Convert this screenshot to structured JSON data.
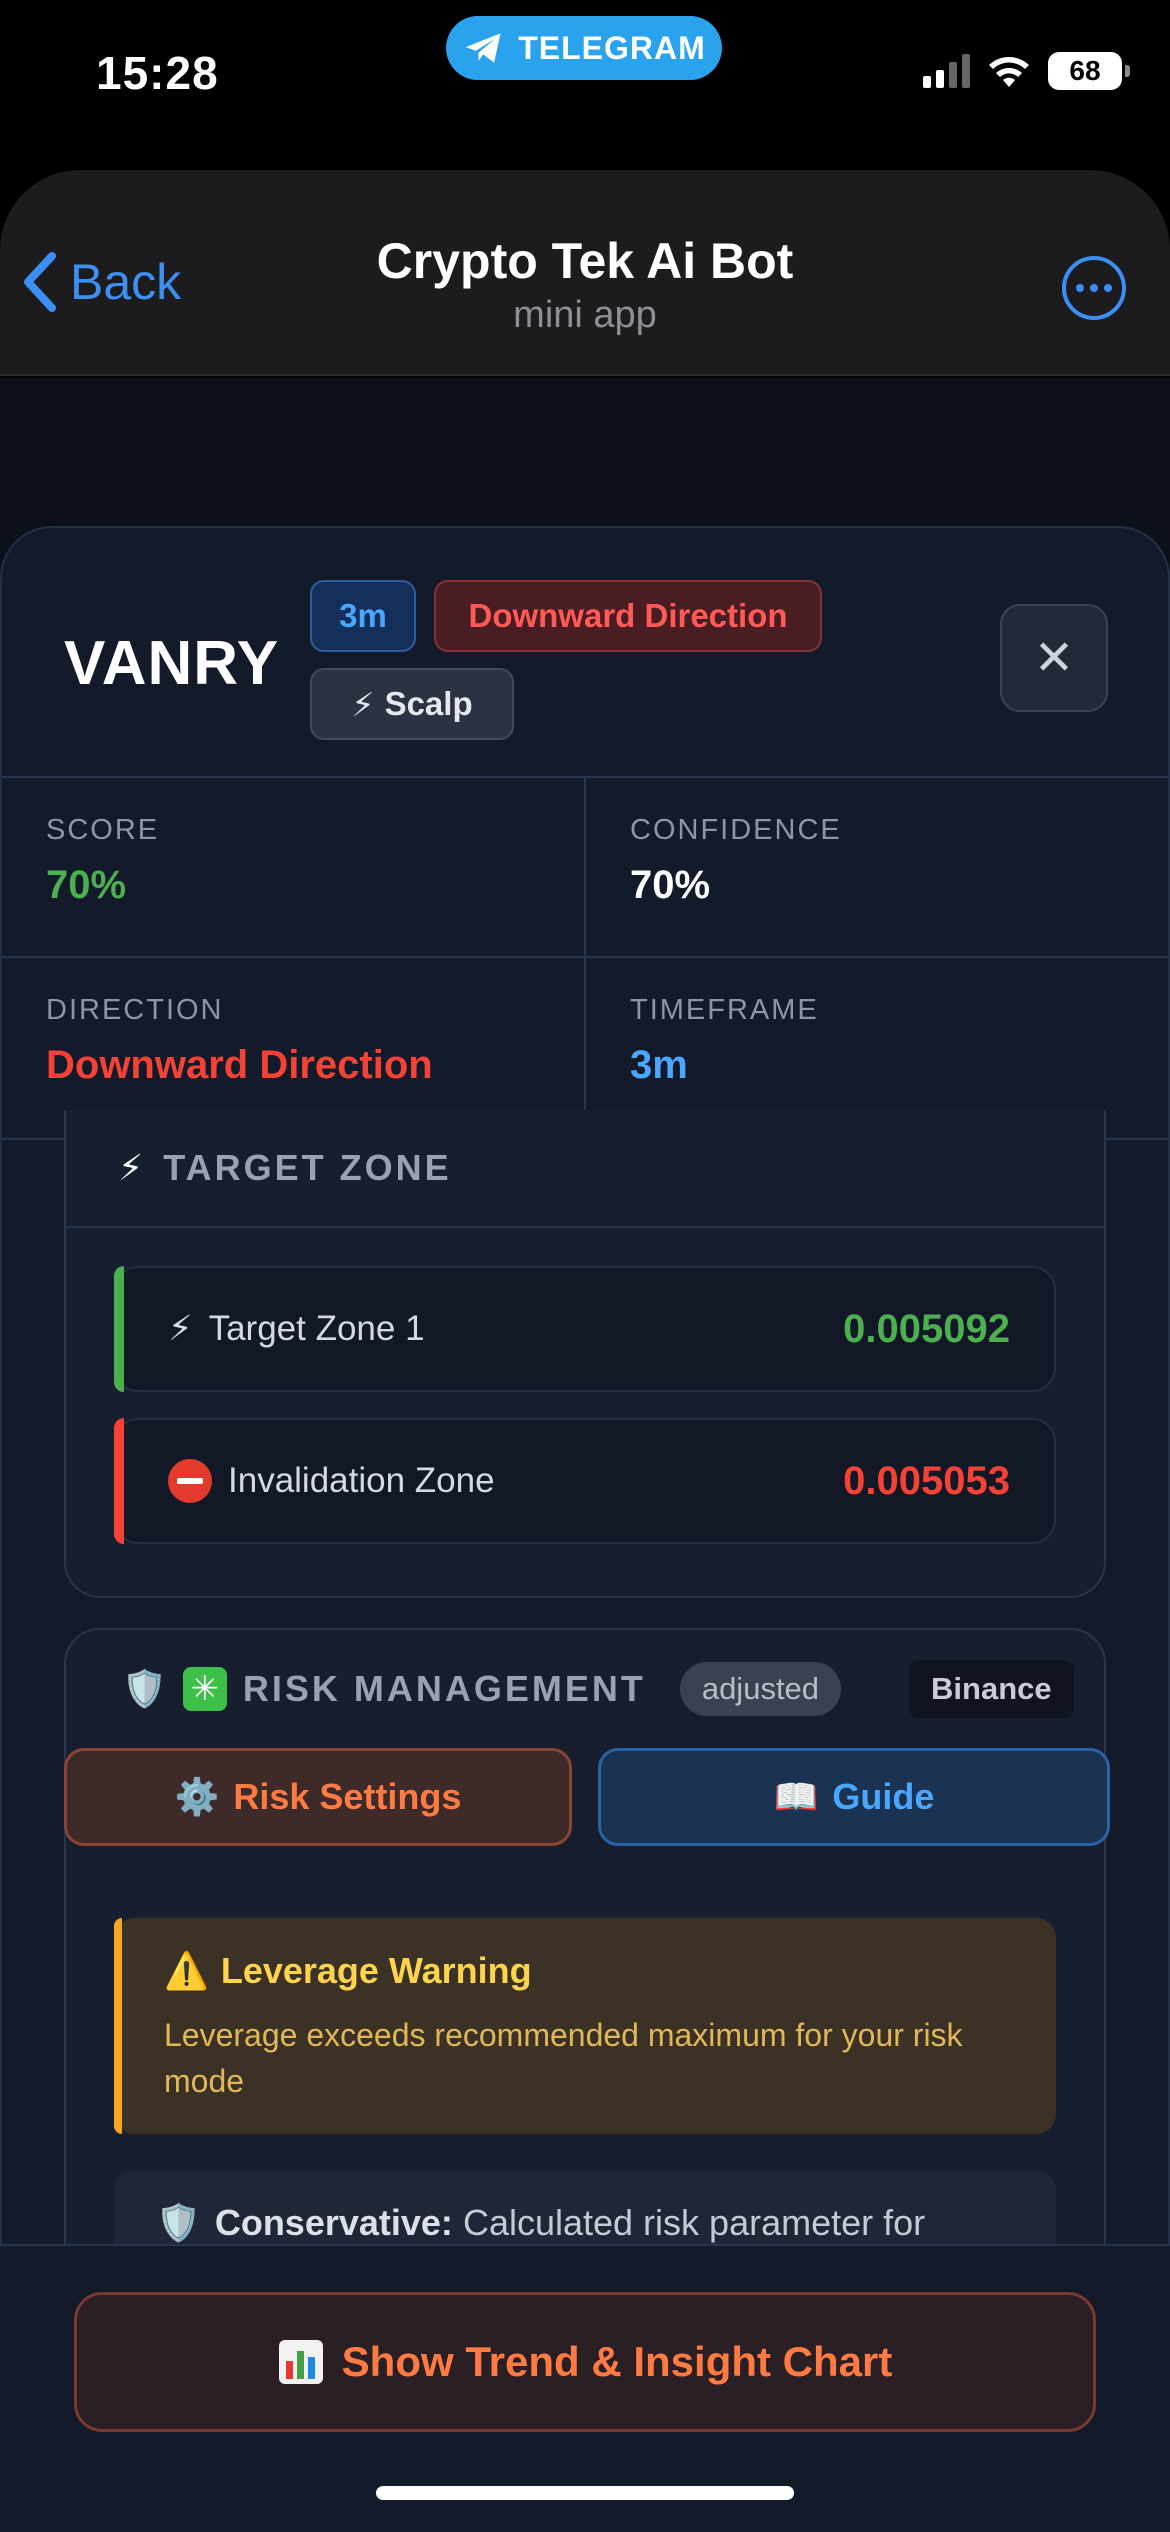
{
  "status_bar": {
    "time": "15:28",
    "app_pill": "TELEGRAM",
    "battery": "68"
  },
  "header": {
    "back_label": "Back",
    "title": "Crypto Tek Ai Bot",
    "subtitle": "mini app"
  },
  "signal": {
    "symbol": "VANRY",
    "badges": {
      "timeframe": "3m",
      "direction": "Downward Direction",
      "style": "Scalp"
    }
  },
  "stats": [
    {
      "label": "SCORE",
      "value": "70%"
    },
    {
      "label": "CONFIDENCE",
      "value": "70%"
    },
    {
      "label": "DIRECTION",
      "value": "Downward Direction"
    },
    {
      "label": "TIMEFRAME",
      "value": "3m"
    }
  ],
  "target_zone": {
    "title": "TARGET ZONE",
    "zones": [
      {
        "label": "Target Zone 1",
        "value": "0.005092"
      },
      {
        "label": "Invalidation Zone",
        "value": "0.005053"
      }
    ]
  },
  "risk": {
    "title": "RISK MANAGEMENT",
    "chip_adjusted": "adjusted",
    "exchange": "Binance",
    "settings_label": "Risk Settings",
    "guide_label": "Guide",
    "warning_title": "Leverage Warning",
    "warning_body": "Leverage exceeds recommended maximum for your risk mode",
    "conservative_label": "Conservative:",
    "conservative_text": "Calculated risk parameter for"
  },
  "footer": {
    "chart_button": "Show Trend & Insight Chart"
  },
  "colors": {
    "positive": "#4caf50",
    "negative": "#f44336",
    "accent": "#4ba6ff",
    "orange": "#ff7b42"
  }
}
